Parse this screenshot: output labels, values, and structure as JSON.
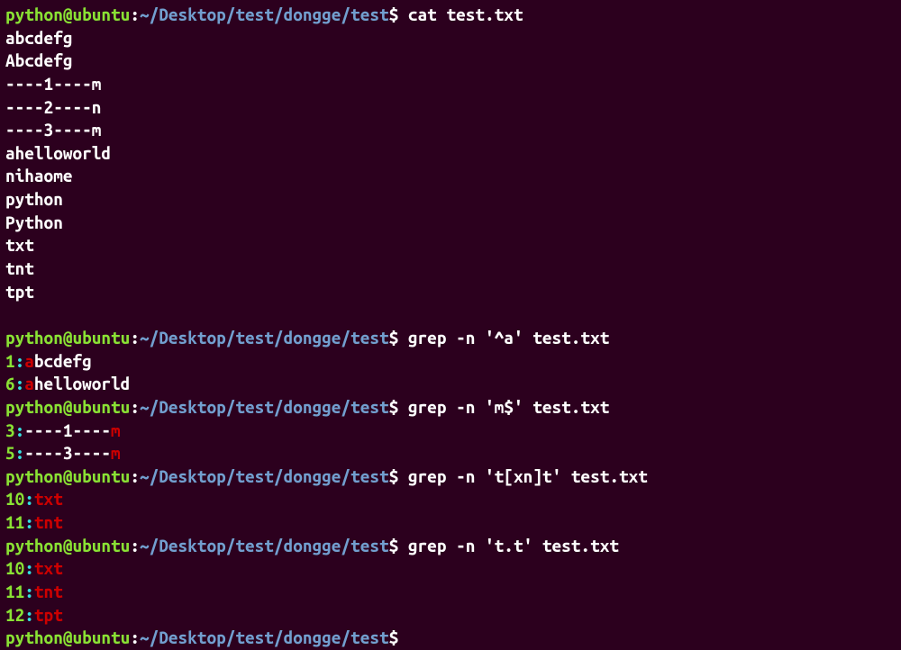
{
  "prompt": {
    "user": "python@ubuntu",
    "colon": ":",
    "tilde": "~",
    "path": "/Desktop/test/dongge/test",
    "dollar": "$"
  },
  "commands": {
    "cat": " cat test.txt",
    "grep1": " grep -n '^a' test.txt",
    "grep2": " grep -n 'm$' test.txt",
    "grep3": " grep -n 't[xn]t' test.txt",
    "grep4": " grep -n 't.t' test.txt",
    "empty": ""
  },
  "cat_output": {
    "l1": "abcdefg",
    "l2": "Abcdefg",
    "l3": "----1----m",
    "l4": "----2----n",
    "l5": "----3----m",
    "l6": "ahelloworld",
    "l7": "nihaome",
    "l8": "python",
    "l9": "Python",
    "l10": "txt",
    "l11": "tnt",
    "l12": "tpt"
  },
  "grep1_out": {
    "r1": {
      "num": "1",
      "sep": ":",
      "match": "a",
      "rest": "bcdefg"
    },
    "r2": {
      "num": "6",
      "sep": ":",
      "match": "a",
      "rest": "helloworld"
    }
  },
  "grep2_out": {
    "r1": {
      "num": "3",
      "sep": ":",
      "rest": "----1----",
      "match": "m"
    },
    "r2": {
      "num": "5",
      "sep": ":",
      "rest": "----3----",
      "match": "m"
    }
  },
  "grep3_out": {
    "r1": {
      "num": "10",
      "sep": ":",
      "match": "txt"
    },
    "r2": {
      "num": "11",
      "sep": ":",
      "match": "tnt"
    }
  },
  "grep4_out": {
    "r1": {
      "num": "10",
      "sep": ":",
      "match": "txt"
    },
    "r2": {
      "num": "11",
      "sep": ":",
      "match": "tnt"
    },
    "r3": {
      "num": "12",
      "sep": ":",
      "match": "tpt"
    }
  }
}
